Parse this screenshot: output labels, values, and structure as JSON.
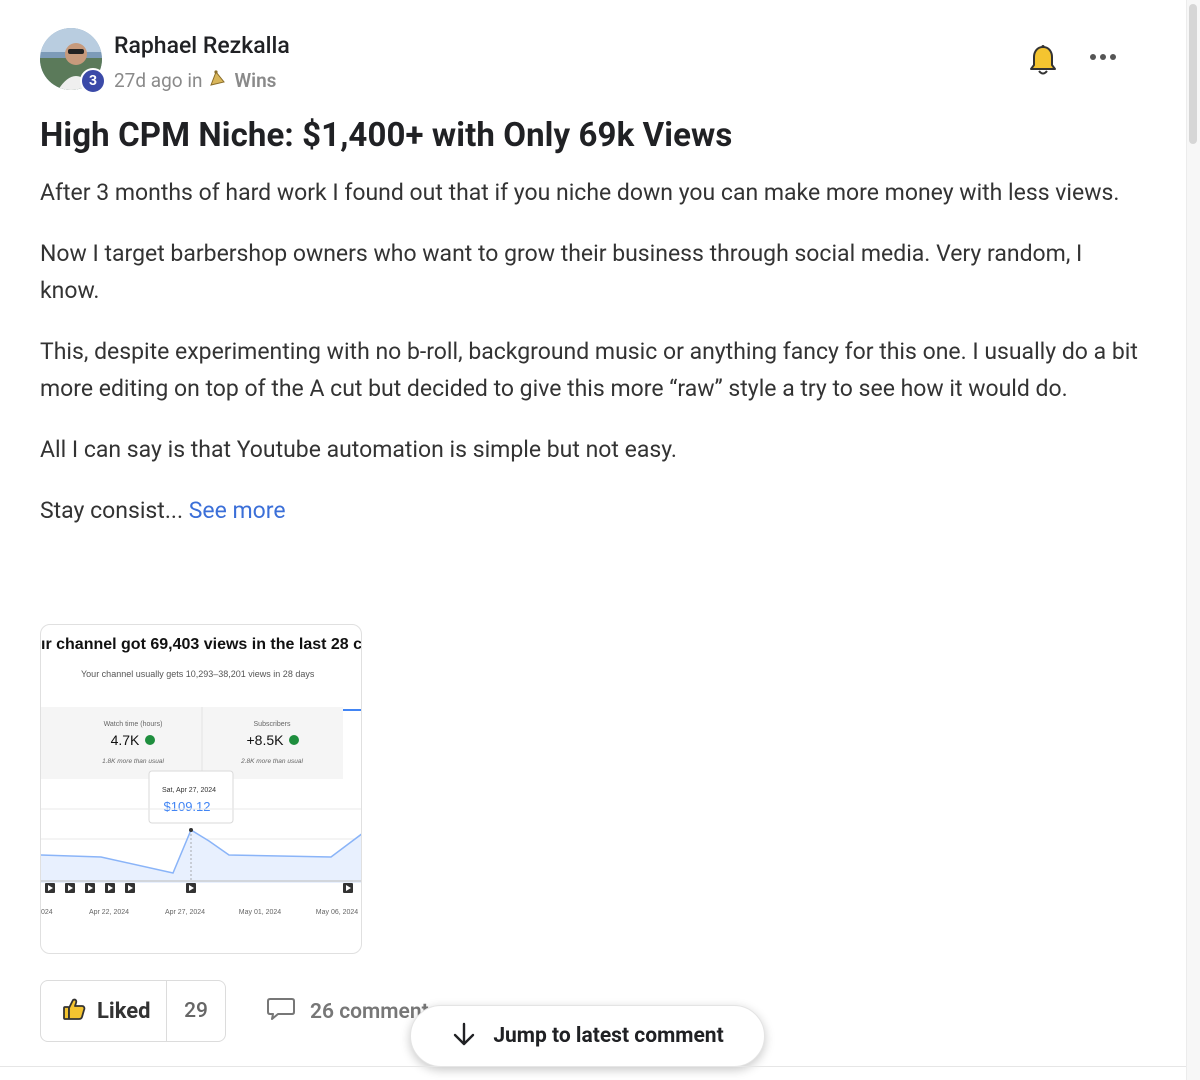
{
  "post": {
    "author": "Raphael Rezkalla",
    "level": "3",
    "time_ago": "27d ago in",
    "category": "Wins",
    "title": "High CPM Niche: $1,400+ with Only 69k Views",
    "paragraphs": [
      "After 3 months of hard work I found out that if you niche down you can make more money with less views.",
      "Now I target barbershop owners who want to grow their business through social media. Very random, I know.",
      "This, despite experimenting with no b-roll, background music or anything fancy for this one. I usually do a bit more editing on top of the A cut but decided to give this more “raw” style a try to see how it would do.",
      "All I can say is that Youtube automation is simple but not easy."
    ],
    "truncated_text": "Stay consist...",
    "see_more": "See more"
  },
  "thumbnail": {
    "headline": "ır channel got 69,403 views in the last 28 c",
    "subline": "Your channel usually gets 10,293–38,201 views in 28 days",
    "stats": [
      {
        "label": "Watch time (hours)",
        "value": "4.7K",
        "note": "1.8K more than usual"
      },
      {
        "label": "Subscribers",
        "value": "+8.5K",
        "note": "2.8K more than usual"
      }
    ],
    "tooltip_date": "Sat, Apr 27, 2024",
    "tooltip_value": "$109.12",
    "x_ticks": [
      "024",
      "Apr 22, 2024",
      "Apr 27, 2024",
      "May 01, 2024",
      "May 06, 2024"
    ],
    "accent_color": "#4285f4"
  },
  "actions": {
    "like_label": "Liked",
    "like_count": "29",
    "comments_label": "26 comments"
  },
  "jump_button": {
    "label": "Jump to latest comment"
  },
  "colors": {
    "link": "#3b6fd8",
    "badge": "#3b4aa8",
    "bell": "#f4c430"
  }
}
